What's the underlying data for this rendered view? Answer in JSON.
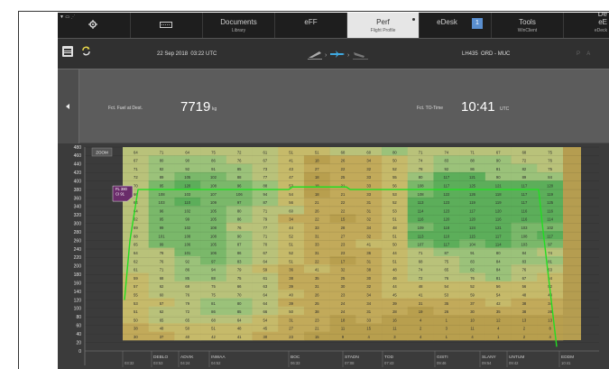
{
  "status_bar": {
    "icons": "▼ ▭ ⋰"
  },
  "menubar": {
    "items": [
      {
        "label": "",
        "sub": "",
        "icon": "gear-icon"
      },
      {
        "label": "",
        "sub": "",
        "icon": "keyboard-icon"
      },
      {
        "label": "Documents",
        "sub": "Library"
      },
      {
        "label": "eFF",
        "sub": ""
      },
      {
        "label": "Perf",
        "sub": "Flight Profile"
      },
      {
        "label": "eDesk",
        "sub": "",
        "badge": "1"
      },
      {
        "label": "Tools",
        "sub": "WinClient"
      },
      {
        "label": "eE",
        "sub": "eDeck",
        "corner": "De"
      }
    ]
  },
  "infobar": {
    "date": "22 Sep 2018",
    "time": "03:22 UTC",
    "flight": "LH435",
    "route": "ORD - MUC",
    "pa": "P A"
  },
  "fuel": {
    "fuel_label": "Fct. Fuel at Dest.",
    "fuel_value": "7719",
    "fuel_unit": "kg",
    "time_label": "Fct. TO-Time",
    "time_value": "10:41",
    "time_unit": "UTC"
  },
  "chart_data": {
    "type": "heatmap",
    "toggle_label": "ZOOM",
    "y_ticks": [
      480,
      460,
      440,
      420,
      400,
      380,
      360,
      340,
      320,
      300,
      280,
      260,
      240,
      220,
      200,
      180,
      160,
      140,
      120,
      100,
      80,
      60,
      40,
      20,
      0
    ],
    "columns": 21,
    "grid": [
      [
        64,
        71,
        64,
        75,
        72,
        61,
        51,
        51,
        68,
        60,
        80,
        71,
        74,
        71,
        67,
        68,
        75
      ],
      [
        67,
        80,
        90,
        86,
        76,
        67,
        41,
        18,
        26,
        34,
        50,
        74,
        83,
        88,
        90,
        72,
        76
      ],
      [
        71,
        82,
        92,
        91,
        85,
        73,
        43,
        27,
        22,
        32,
        52,
        78,
        92,
        86,
        81,
        82,
        75
      ],
      [
        72,
        89,
        105,
        102,
        88,
        77,
        47,
        18,
        25,
        33,
        55,
        80,
        117,
        121,
        90,
        89,
        84
      ],
      [
        70,
        95,
        120,
        108,
        96,
        88,
        53,
        18,
        21,
        33,
        56,
        108,
        117,
        125,
        121,
        117,
        120
      ],
      [
        66,
        108,
        103,
        107,
        106,
        94,
        54,
        18,
        21,
        33,
        53,
        108,
        122,
        126,
        118,
        117,
        119
      ],
      [
        64,
        103,
        110,
        109,
        97,
        87,
        56,
        21,
        22,
        31,
        52,
        113,
        123,
        119,
        119,
        117,
        125
      ],
      [
        64,
        96,
        102,
        105,
        80,
        71,
        60,
        26,
        22,
        31,
        53,
        114,
        123,
        117,
        120,
        116,
        116
      ],
      [
        62,
        95,
        99,
        105,
        86,
        79,
        34,
        22,
        15,
        32,
        51,
        116,
        120,
        120,
        116,
        116,
        114
      ],
      [
        69,
        99,
        102,
        108,
        76,
        77,
        44,
        33,
        28,
        34,
        48,
        109,
        118,
        124,
        121,
        103,
        102
      ],
      [
        68,
        101,
        108,
        108,
        90,
        71,
        52,
        31,
        27,
        32,
        51,
        113,
        110,
        115,
        117,
        108,
        117
      ],
      [
        65,
        99,
        106,
        105,
        87,
        70,
        51,
        33,
        23,
        41,
        50,
        107,
        117,
        104,
        114,
        103,
        97
      ],
      [
        64,
        78,
        101,
        106,
        86,
        67,
        52,
        31,
        23,
        36,
        44,
        71,
        87,
        91,
        80,
        84,
        74
      ],
      [
        62,
        76,
        92,
        97,
        83,
        64,
        51,
        22,
        17,
        31,
        51,
        68,
        75,
        83,
        84,
        83,
        81
      ],
      [
        61,
        71,
        86,
        94,
        79,
        59,
        36,
        41,
        32,
        38,
        48,
        74,
        65,
        82,
        84,
        76,
        63
      ],
      [
        59,
        68,
        85,
        88,
        75,
        61,
        38,
        35,
        25,
        30,
        46,
        72,
        76,
        76,
        81,
        67,
        54
      ],
      [
        57,
        62,
        69,
        75,
        66,
        63,
        39,
        31,
        30,
        32,
        44,
        48,
        54,
        52,
        56,
        56,
        52
      ],
      [
        55,
        60,
        76,
        75,
        70,
        64,
        40,
        26,
        23,
        34,
        45,
        41,
        53,
        59,
        54,
        48,
        43
      ],
      [
        53,
        57,
        79,
        81,
        80,
        64,
        39,
        25,
        24,
        34,
        39,
        31,
        35,
        37,
        42,
        38,
        34
      ],
      [
        51,
        62,
        72,
        86,
        85,
        66,
        50,
        38,
        24,
        31,
        28,
        19,
        26,
        30,
        35,
        38,
        26
      ],
      [
        50,
        65,
        65,
        68,
        64,
        54,
        31,
        23,
        18,
        33,
        16,
        4,
        1,
        10,
        12,
        13,
        13
      ],
      [
        38,
        48,
        50,
        51,
        48,
        45,
        27,
        21,
        11,
        15,
        11,
        2,
        3,
        11,
        4,
        2,
        8
      ],
      [
        30,
        37,
        40,
        42,
        41,
        30,
        23,
        15,
        9,
        4,
        3,
        4,
        1,
        4,
        1,
        2,
        4
      ]
    ],
    "profile_label_line1": "FL 380",
    "profile_label_line2": "CI 91",
    "waypoints": [
      {
        "name": "",
        "time": "03:32"
      },
      {
        "name": "DEBLO",
        "time": "03:53"
      },
      {
        "name": "ADVIK",
        "time": "04:24"
      },
      {
        "name": "INWAA",
        "time": "04:52"
      },
      {
        "name": "BOC",
        "time": "06:33"
      },
      {
        "name": "STADN",
        "time": "07:08"
      },
      {
        "name": "TOD",
        "time": "07:43"
      },
      {
        "name": "GISTI",
        "time": "09:46"
      },
      {
        "name": "SLANY",
        "time": "09:54"
      },
      {
        "name": "UNTUM",
        "time": "09:42"
      },
      {
        "name": "EDDM",
        "time": "10:41"
      }
    ],
    "profile": {
      "cruise_fl": 380,
      "climb_start": 120,
      "descent_end": 10
    },
    "colors": {
      "line": "#22dd22",
      "tag": "#6a2c6a"
    }
  }
}
